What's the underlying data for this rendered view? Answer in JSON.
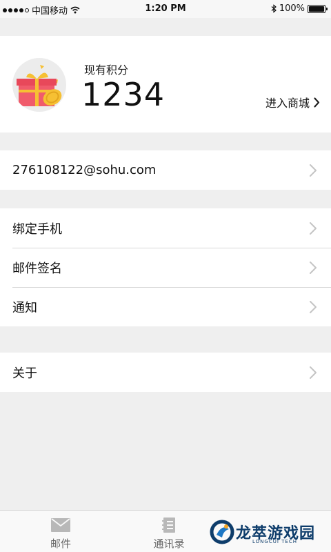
{
  "status_bar": {
    "carrier": "中国移动",
    "time": "1:20 PM",
    "battery": "100%",
    "battery_level": 1.0
  },
  "points_card": {
    "label": "现有积分",
    "value": "1234",
    "mall_link": "进入商城",
    "icon": "gift-icon"
  },
  "account": {
    "email": "276108122@sohu.com"
  },
  "settings": {
    "items": [
      {
        "label": "绑定手机"
      },
      {
        "label": "邮件签名"
      },
      {
        "label": "通知"
      }
    ]
  },
  "about": {
    "label": "关于"
  },
  "tab_bar": {
    "tabs": [
      {
        "label": "邮件",
        "icon": "mail-icon"
      },
      {
        "label": "通讯录",
        "icon": "contacts-icon"
      }
    ]
  },
  "watermark": {
    "text": "龙萃游戏园",
    "sub": "LONGCUI TECH"
  },
  "colors": {
    "background": "#efefef",
    "card": "#ffffff",
    "divider": "#d8d8d8",
    "chevron": "#c4c4c4",
    "gift_red": "#e8485a",
    "gift_yellow": "#f6c033"
  }
}
